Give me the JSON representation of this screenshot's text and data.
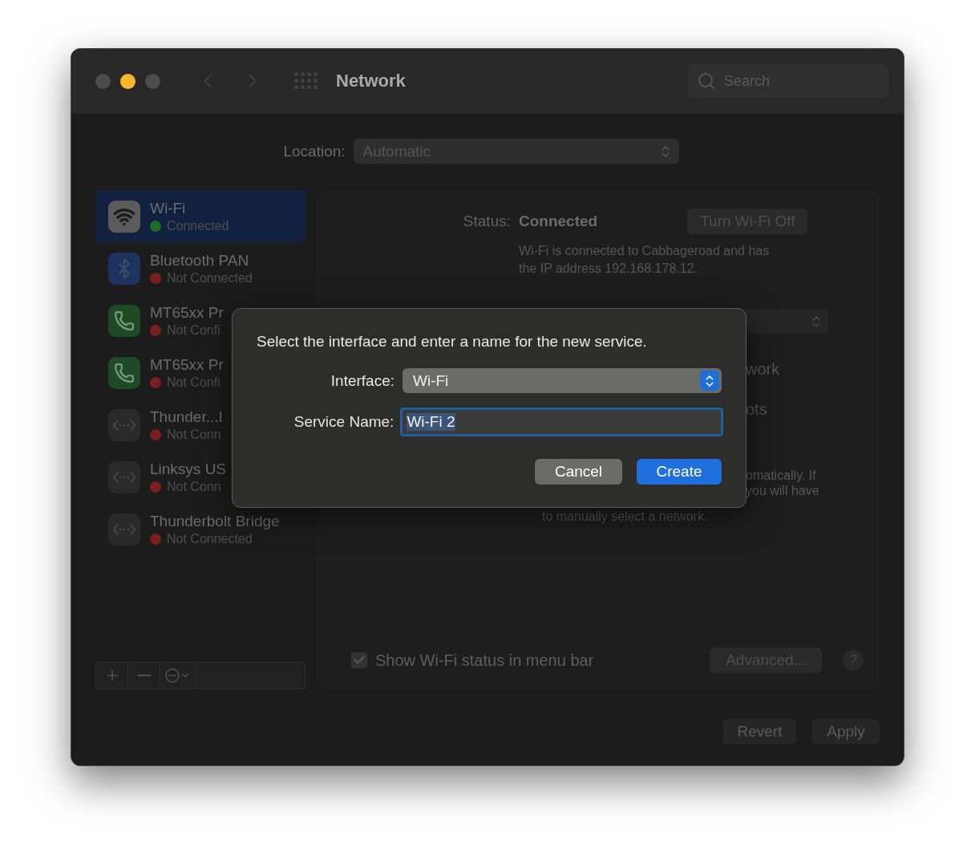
{
  "window": {
    "title": "Network",
    "traffic_lights": [
      {
        "kind": "close",
        "active": false
      },
      {
        "kind": "minimize",
        "active": true
      },
      {
        "kind": "zoom",
        "active": false
      }
    ]
  },
  "search": {
    "placeholder": "Search"
  },
  "location": {
    "label": "Location:",
    "value": "Automatic"
  },
  "services": [
    {
      "name": "Wi-Fi",
      "status": "Connected",
      "color": "#1f6b2a",
      "kind": "wifi",
      "selected": true
    },
    {
      "name": "Bluetooth PAN",
      "status": "Not Connected",
      "color": "#7a1f1f",
      "kind": "bluetooth",
      "selected": false
    },
    {
      "name": "MT65xx Pr",
      "status": "Not Confi",
      "color": "#7a1f1f",
      "kind": "phone",
      "selected": false
    },
    {
      "name": "MT65xx Pr",
      "status": "Not Confi",
      "color": "#7a1f1f",
      "kind": "phone",
      "selected": false
    },
    {
      "name": "Thunder...I",
      "status": "Not Conn",
      "color": "#7a1f1f",
      "kind": "ethernet",
      "selected": false
    },
    {
      "name": "Linksys US",
      "status": "Not Conn",
      "color": "#7a1f1f",
      "kind": "ethernet",
      "selected": false
    },
    {
      "name": "Thunderbolt Bridge",
      "status": "Not Connected",
      "color": "#7a1f1f",
      "kind": "ethernet",
      "selected": false
    }
  ],
  "detail": {
    "status_label": "Status:",
    "status_value": "Connected",
    "turn_off_button": "Turn Wi-Fi Off",
    "description": [
      "Wi-Fi is connected to Cabbageroad and has",
      "the IP address 192.168.178.12."
    ],
    "partial_rows": [
      "work",
      "ots"
    ],
    "partial_text": [
      "omatically. If",
      "you will have",
      "to manually select a network."
    ],
    "show_status": {
      "label": "Show Wi-Fi status in menu bar",
      "checked": true
    },
    "advanced_button": "Advanced...",
    "help_button": "?"
  },
  "footer": {
    "buttons": [
      "Revert",
      "Apply"
    ]
  },
  "dialog": {
    "message": "Select the interface and enter a name for the new service.",
    "interface_label": "Interface:",
    "interface_value": "Wi-Fi",
    "service_name_label": "Service Name:",
    "service_name_value": "Wi-Fi 2",
    "buttons": [
      {
        "label": "Cancel",
        "kind": "secondary"
      },
      {
        "label": "Create",
        "kind": "primary"
      }
    ]
  }
}
